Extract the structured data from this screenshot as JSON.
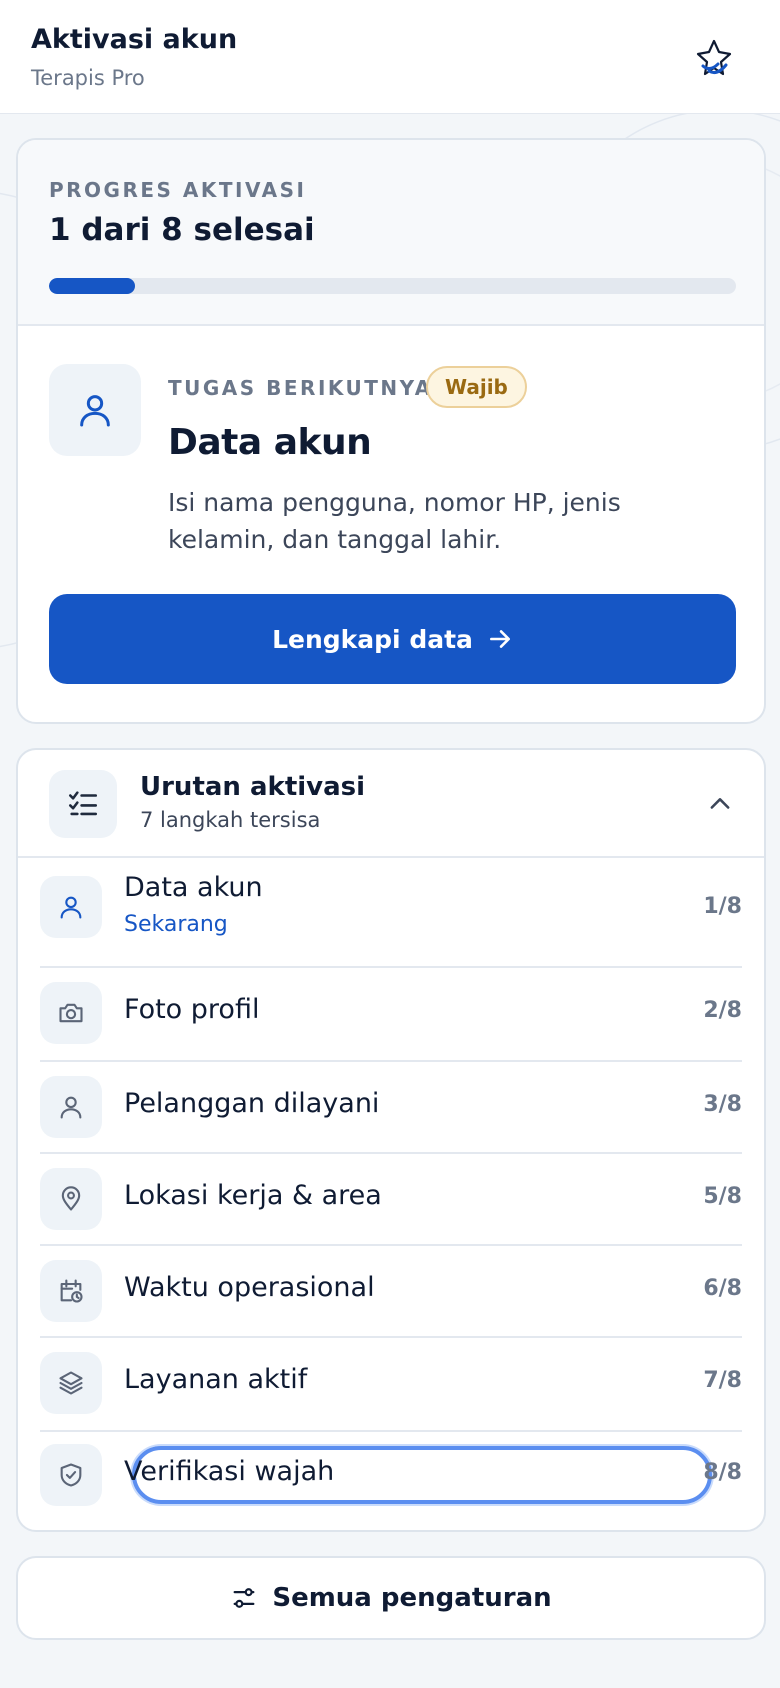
{
  "header": {
    "title": "Aktivasi akun",
    "subtitle": "Terapis Pro",
    "logo_icon": "star-hands-logo-icon"
  },
  "progress": {
    "label": "PROGRES AKTIVASI",
    "count_text": "1 dari 8 selesai",
    "completed": 1,
    "total": 8,
    "fill_fraction": 0.125,
    "bar_color": "#1656c5"
  },
  "next_task": {
    "label": "TUGAS BERIKUTNYA",
    "badge": "Wajib",
    "title": "Data akun",
    "description": "Isi nama pengguna, nomor HP, jenis kelamin, dan tanggal lahir.",
    "cta_label": "Lengkapi data",
    "icon": "user-icon"
  },
  "steps": {
    "title": "Urutan aktivasi",
    "subtitle": "7 langkah tersisa",
    "items": [
      {
        "label": "Data akun",
        "sub": "Sekarang",
        "num": "1/8",
        "icon": "user-icon"
      },
      {
        "label": "Foto profil",
        "num": "2/8",
        "icon": "camera-icon"
      },
      {
        "label": "Pelanggan dilayani",
        "num": "3/8",
        "icon": "user-icon"
      },
      {
        "label": "Lokasi kerja & area",
        "num": "5/8",
        "icon": "map-pin-icon"
      },
      {
        "label": "Waktu operasional",
        "num": "6/8",
        "icon": "calendar-clock-icon"
      },
      {
        "label": "Layanan aktif",
        "num": "7/8",
        "icon": "layers-icon"
      },
      {
        "label": "Verifikasi wajah",
        "num": "8/8",
        "icon": "shield-check-icon"
      }
    ]
  },
  "footer": {
    "settings_label": "Semua pengaturan",
    "icon": "sliders-icon"
  },
  "colors": {
    "accent": "#1656c5",
    "badge_bg": "#fdf5e1",
    "badge_text": "#9a6a12"
  }
}
